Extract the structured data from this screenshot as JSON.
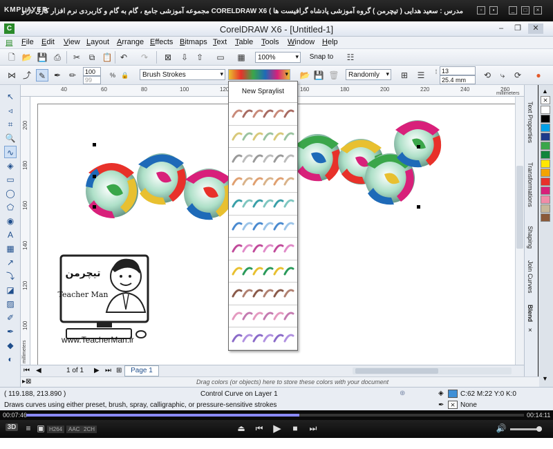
{
  "player": {
    "brand": "KMPLAYER",
    "video_title": "مجموعه آموزشی جامع ، گام به گام و کاربردی نرم افزار کارل دراو CORELDRAW X6 ( مدرس : سعید هدایی ( تیچرمن ) گروه آموزشی پادشاه گرافیست ها",
    "elapsed": "00:07:46",
    "duration": "00:14:11",
    "progress": 0.548,
    "badges": [
      "H264",
      "AAC",
      "2CH"
    ]
  },
  "app": {
    "title": "CorelDRAW X6 - [Untitled-1]",
    "logo": "C"
  },
  "menu": [
    "File",
    "Edit",
    "View",
    "Layout",
    "Arrange",
    "Effects",
    "Bitmaps",
    "Text",
    "Table",
    "Tools",
    "Window",
    "Help"
  ],
  "standard_toolbar": {
    "zoom": "100%",
    "snap_to": "Snap to"
  },
  "property_bar": {
    "size_a": "100",
    "size_b": "99",
    "category": "Brush Strokes",
    "order": "Randomly",
    "spacing": "13",
    "distance": "25.4 mm"
  },
  "rulers": {
    "h_labels": [
      "40",
      "60",
      "80",
      "100",
      "120",
      "140",
      "160",
      "180",
      "200",
      "220",
      "240",
      "260"
    ],
    "v_labels": [
      "200",
      "180",
      "160",
      "140",
      "120",
      "100"
    ],
    "units": "millimeters"
  },
  "spraylist": {
    "new_label": "New Spraylist",
    "items": [
      {
        "name": "brush-stroke-brown",
        "colors": [
          "#c98a7a",
          "#a86b62"
        ]
      },
      {
        "name": "brush-stroke-pastel",
        "colors": [
          "#d8c97a",
          "#9bc3a0"
        ]
      },
      {
        "name": "brush-stroke-grey",
        "colors": [
          "#999999",
          "#bbbbbb"
        ]
      },
      {
        "name": "brush-stroke-warm",
        "colors": [
          "#e0a070",
          "#d9b38a"
        ]
      },
      {
        "name": "feather-teal",
        "colors": [
          "#3aa0a8",
          "#7fc6c0"
        ]
      },
      {
        "name": "feather-blue",
        "colors": [
          "#4a8ad0",
          "#9cc4e8"
        ]
      },
      {
        "name": "swirl-magenta",
        "colors": [
          "#c04a9a",
          "#e08ac8"
        ]
      },
      {
        "name": "swirl-rainbow",
        "colors": [
          "#e8c030",
          "#2a9a5a"
        ]
      },
      {
        "name": "script-brown",
        "colors": [
          "#8a5a4a",
          "#b08070"
        ]
      },
      {
        "name": "brush-stroke-pink",
        "colors": [
          "#e49ac0",
          "#c47ab0"
        ]
      },
      {
        "name": "brush-stroke-violet",
        "colors": [
          "#8a6ac8",
          "#b090e0"
        ]
      }
    ]
  },
  "teacher": {
    "logo_fa": "تیچرمن",
    "name": "Teacher Man",
    "url": "www.TeacherMan.ir"
  },
  "dockers": [
    "Text Properties",
    "Transformations",
    "Shaping",
    "Join Curves",
    "Blend"
  ],
  "palette": [
    "#ffffff",
    "#000000",
    "#00a0e8",
    "#1e3a8a",
    "#3aa64a",
    "#12853c",
    "#ffe600",
    "#f4a300",
    "#e8312a",
    "#d8207a",
    "#f18ca8",
    "#c8b89a",
    "#8a5a3a"
  ],
  "page_nav": {
    "count": "1 of 1",
    "tab": "Page 1"
  },
  "color_hint": "Drag colors (or objects) here to store these colors with your document",
  "status": {
    "coords": "( 119.188, 213.890 )",
    "selection": "Control Curve on Layer 1",
    "hint": "Draws curves using either preset, brush, spray, calligraphic, or pressure-sensitive strokes",
    "fill": "C:62 M:22 Y:0 K:0",
    "outline": "None",
    "fill_color": "#3e8fd6"
  }
}
